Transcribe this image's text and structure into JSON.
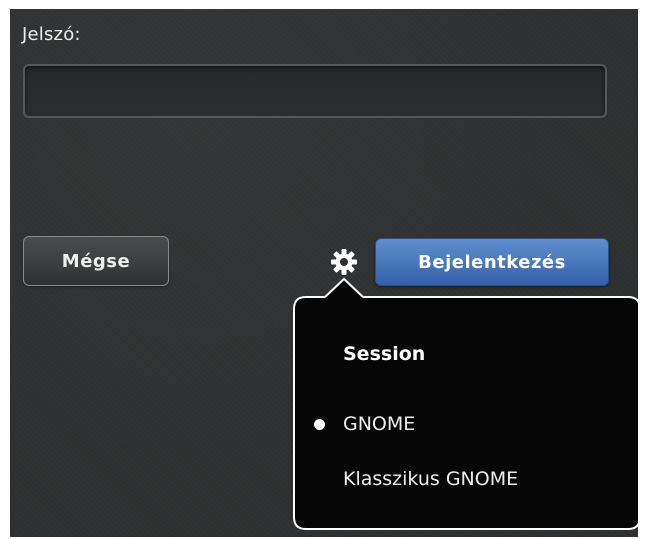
{
  "login": {
    "password_label": "Jelszó:",
    "password_value": "",
    "cancel_label": "Mégse",
    "login_label": "Bejelentkezés"
  },
  "session_menu": {
    "header": "Session",
    "items": [
      {
        "label": "GNOME",
        "selected": true
      },
      {
        "label": "Klasszikus GNOME",
        "selected": false
      }
    ]
  },
  "colors": {
    "background": "#2e3031",
    "login_button": "#4a78bd",
    "popover_background": "#060606",
    "popover_border": "#ffffff",
    "text": "#eeeeec"
  },
  "icons": {
    "session_button": "gear-icon",
    "selected_item": "bullet-icon"
  }
}
